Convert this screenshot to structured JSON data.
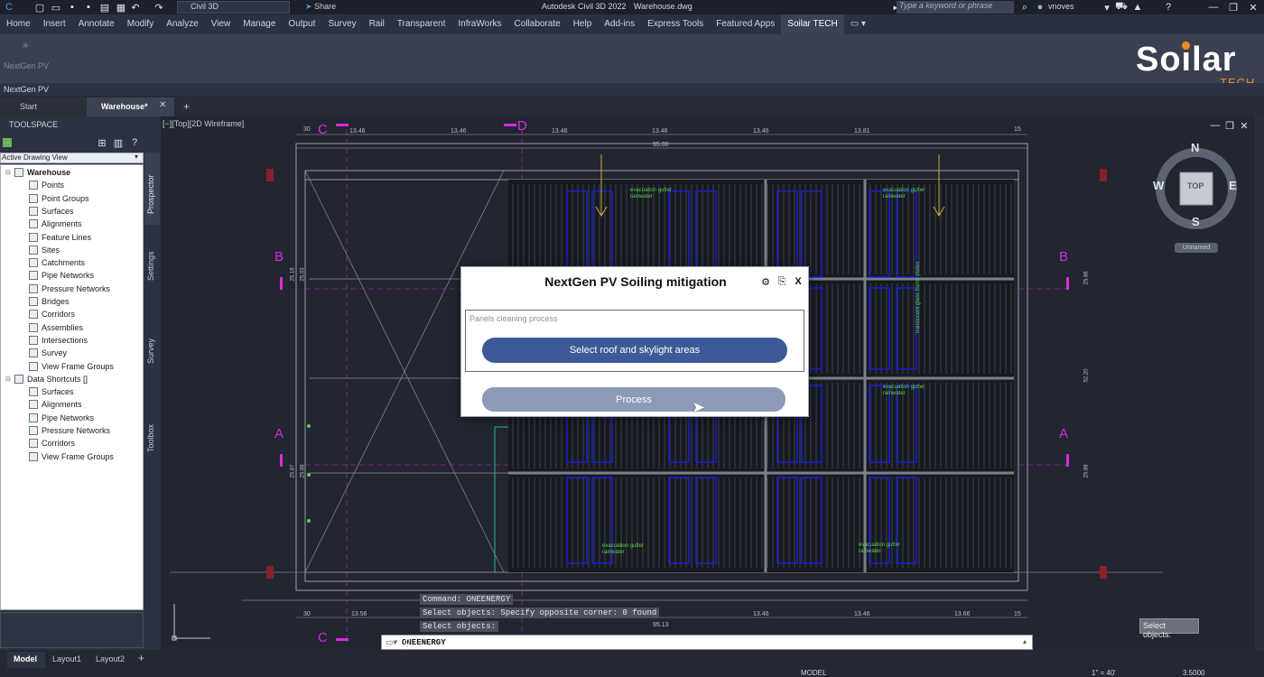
{
  "titlebar": {
    "product": "Civil 3D",
    "share_label": "Share",
    "app_title": "Autodesk Civil 3D 2022",
    "file_name": "Warehouse.dwg",
    "search_placeholder": "Type a keyword or phrase",
    "user": "vnoves"
  },
  "ribbon": {
    "tabs": [
      "Home",
      "Insert",
      "Annotate",
      "Modify",
      "Analyze",
      "View",
      "Manage",
      "Output",
      "Survey",
      "Rail",
      "Transparent",
      "InfraWorks",
      "Collaborate",
      "Help",
      "Add-ins",
      "Express Tools",
      "Featured Apps",
      "Soilar TECH"
    ],
    "active_tab": "Soilar TECH",
    "panel_button_label": "NextGen PV",
    "panel_name": "NextGen PV"
  },
  "logo": {
    "main": "Soilar",
    "sub": "TECH"
  },
  "doc_tabs": {
    "start": "Start",
    "active": "Warehouse*"
  },
  "toolspace": {
    "title": "TOOLSPACE",
    "view_selector": "Active Drawing View",
    "side_tabs": [
      "Prospector",
      "Settings",
      "Survey",
      "Toolbox"
    ],
    "tree": [
      {
        "label": "Warehouse",
        "level": 0,
        "bold": true
      },
      {
        "label": "Points",
        "level": 1
      },
      {
        "label": "Point Groups",
        "level": 1
      },
      {
        "label": "Surfaces",
        "level": 1
      },
      {
        "label": "Alignments",
        "level": 1
      },
      {
        "label": "Feature Lines",
        "level": 1
      },
      {
        "label": "Sites",
        "level": 1
      },
      {
        "label": "Catchments",
        "level": 1
      },
      {
        "label": "Pipe Networks",
        "level": 1
      },
      {
        "label": "Pressure Networks",
        "level": 1
      },
      {
        "label": "Bridges",
        "level": 1
      },
      {
        "label": "Corridors",
        "level": 1
      },
      {
        "label": "Assemblies",
        "level": 1
      },
      {
        "label": "Intersections",
        "level": 1
      },
      {
        "label": "Survey",
        "level": 1
      },
      {
        "label": "View Frame Groups",
        "level": 1
      },
      {
        "label": "Data Shortcuts []",
        "level": 0
      },
      {
        "label": "Surfaces",
        "level": 1
      },
      {
        "label": "Alignments",
        "level": 1
      },
      {
        "label": "Pipe Networks",
        "level": 1
      },
      {
        "label": "Pressure Networks",
        "level": 1
      },
      {
        "label": "Corridors",
        "level": 1
      },
      {
        "label": "View Frame Groups",
        "level": 1
      }
    ]
  },
  "viewport": {
    "label": "[−][Top][2D Wireframe]",
    "viewcube": {
      "n": "N",
      "s": "S",
      "e": "E",
      "w": "W",
      "top": "TOP",
      "ucs": "Unnamed"
    },
    "grid_letters": [
      "C",
      "D",
      "B",
      "B",
      "A",
      "A",
      "C"
    ],
    "dims_top": [
      "13.46",
      "13.46",
      "13.46",
      "13.46",
      "13.46",
      "13.81"
    ],
    "overall_top": "95.00",
    "grid_numbers_top": [
      "30",
      "15"
    ],
    "dims_bottom": [
      "13.56",
      "13.46",
      "13.46",
      "13.66"
    ],
    "overall_bottom": "95.13",
    "grid_numbers_bottom": [
      "30",
      "15"
    ],
    "dims_left": [
      "25.18",
      "25.03",
      "25.87",
      "25.88"
    ],
    "dims_right": [
      "25.88",
      "52.20",
      "25.88"
    ],
    "annotations": [
      "evacuation gutter",
      "rainwater",
      "translucent glass forms plates"
    ],
    "tooltip": "Select objects:"
  },
  "dialog": {
    "title": "NextGen PV Soiling mitigation",
    "group_label": "Panels cleaning process",
    "primary_button": "Select roof and skylight areas",
    "secondary_button": "Process",
    "colors": {
      "primary": "#3d5a98",
      "secondary": "#8d9ab8"
    }
  },
  "command": {
    "history": [
      "Command: ONEENERGY",
      "Select objects: Specify opposite corner: 0 found",
      "Select objects:"
    ],
    "input": "ONEENERGY"
  },
  "status": {
    "layout_tabs": [
      "Model",
      "Layout1",
      "Layout2"
    ],
    "model_label": "MODEL",
    "scale": "1\" = 40'",
    "value": "3.5000"
  }
}
